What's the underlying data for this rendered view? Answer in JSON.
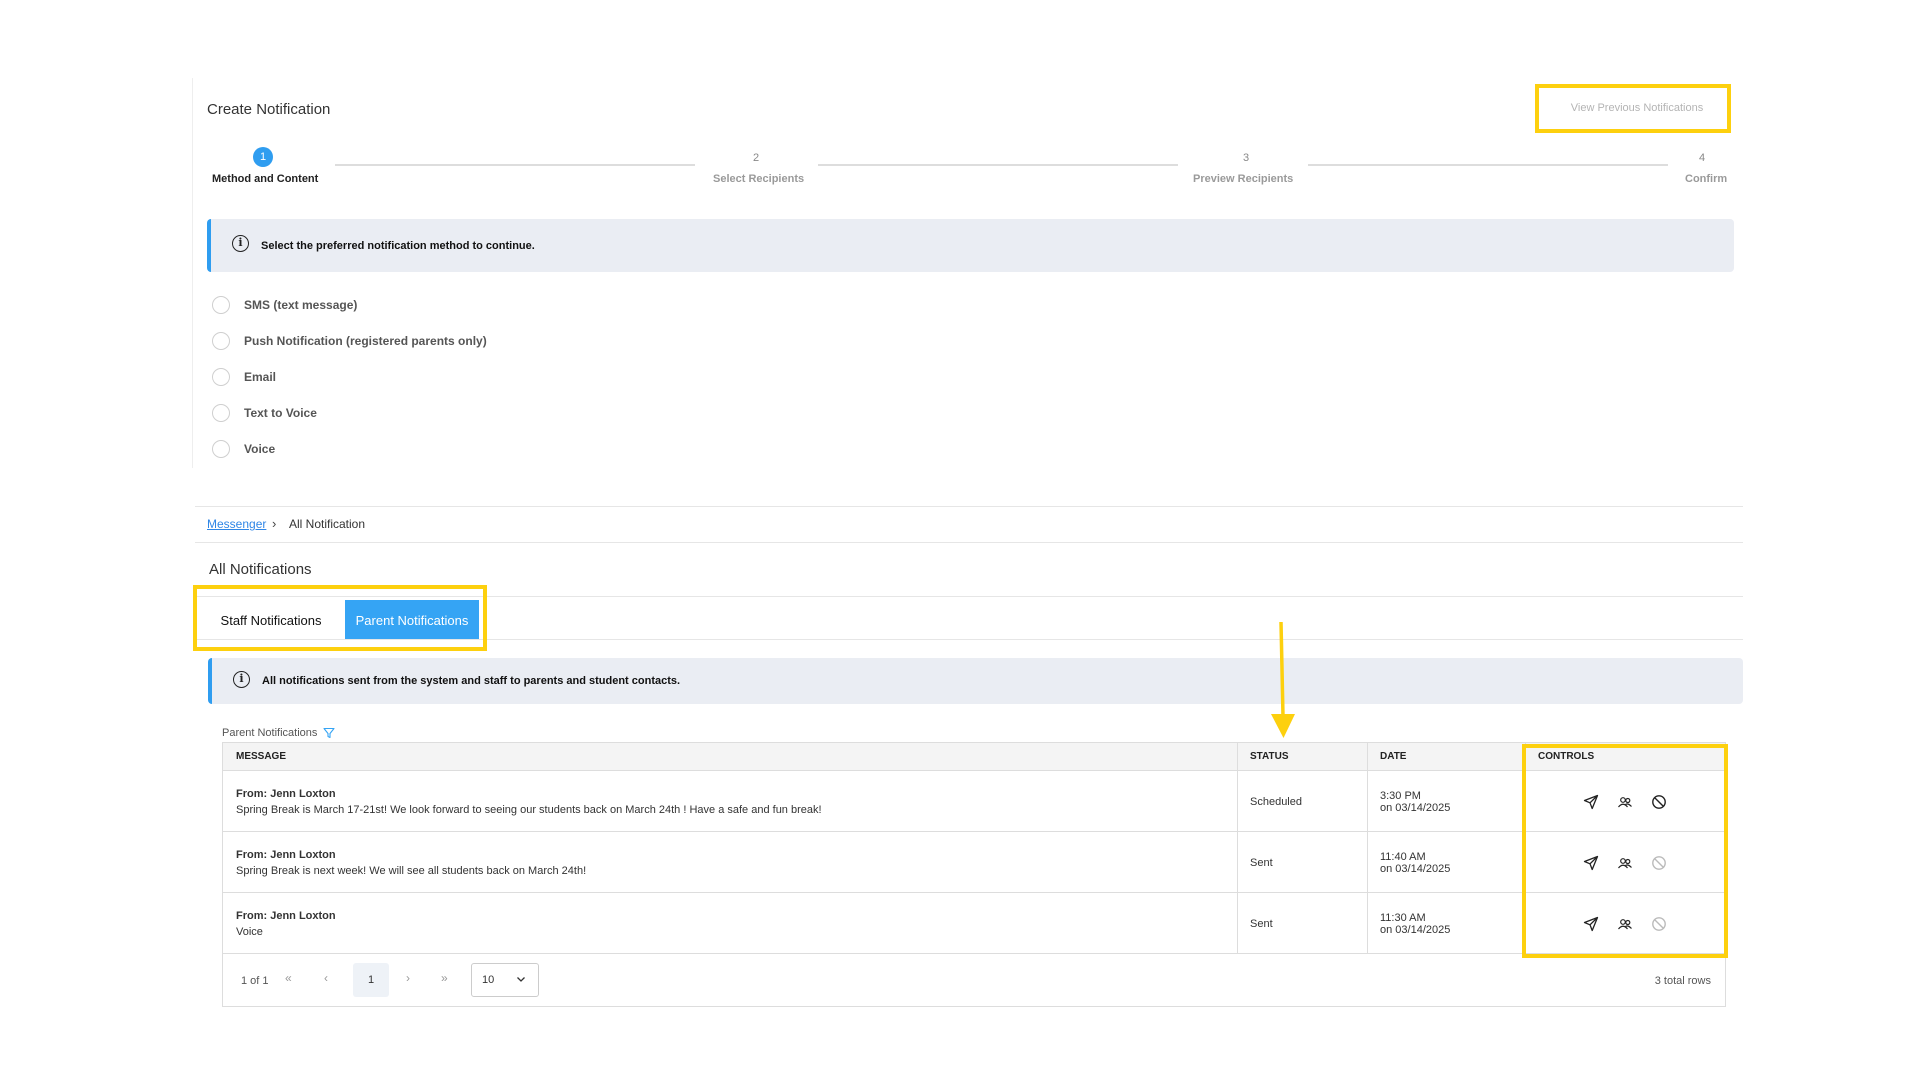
{
  "create": {
    "title": "Create Notification",
    "view_previous": "View Previous Notifications",
    "steps": [
      {
        "num": "1",
        "label": "Method and Content"
      },
      {
        "num": "2",
        "label": "Select Recipients"
      },
      {
        "num": "3",
        "label": "Preview Recipients"
      },
      {
        "num": "4",
        "label": "Confirm"
      }
    ],
    "info": "Select the preferred notification method to continue.",
    "methods": [
      "SMS (text message)",
      "Push Notification (registered parents only)",
      "Email",
      "Text to Voice",
      "Voice"
    ]
  },
  "breadcrumb": {
    "link": "Messenger",
    "current": "All Notification"
  },
  "notifications": {
    "title": "All Notifications",
    "tabs": {
      "staff": "Staff Notifications",
      "parent": "Parent Notifications"
    },
    "info": "All notifications sent from the system and staff to parents and student contacts.",
    "table_caption": "Parent Notifications",
    "columns": {
      "message": "MESSAGE",
      "status": "STATUS",
      "date": "DATE",
      "controls": "CONTROLS"
    },
    "rows": [
      {
        "from": "From: Jenn Loxton",
        "message": "Spring Break is March 17-21st! We look forward to seeing our students back on March 24th ! Have a safe and fun break!",
        "status": "Scheduled",
        "time": "3:30 PM",
        "date": "on 03/14/2025"
      },
      {
        "from": "From: Jenn Loxton",
        "message": "Spring Break is next week! We will see all students back on March 24th!",
        "status": "Sent",
        "time": "11:40 AM",
        "date": "on 03/14/2025"
      },
      {
        "from": "From: Jenn Loxton",
        "message": "Voice",
        "status": "Sent",
        "time": "11:30 AM",
        "date": "on 03/14/2025"
      }
    ],
    "pager": {
      "page_info": "1 of 1",
      "current": "1",
      "page_size": "10",
      "total": "3 total rows"
    }
  },
  "colors": {
    "accent": "#35a4f4",
    "highlight": "#fdd00e"
  },
  "icons": [
    "info-icon",
    "filter-icon",
    "send-icon",
    "recipients-icon",
    "cancel-icon",
    "chevron-down-icon"
  ]
}
